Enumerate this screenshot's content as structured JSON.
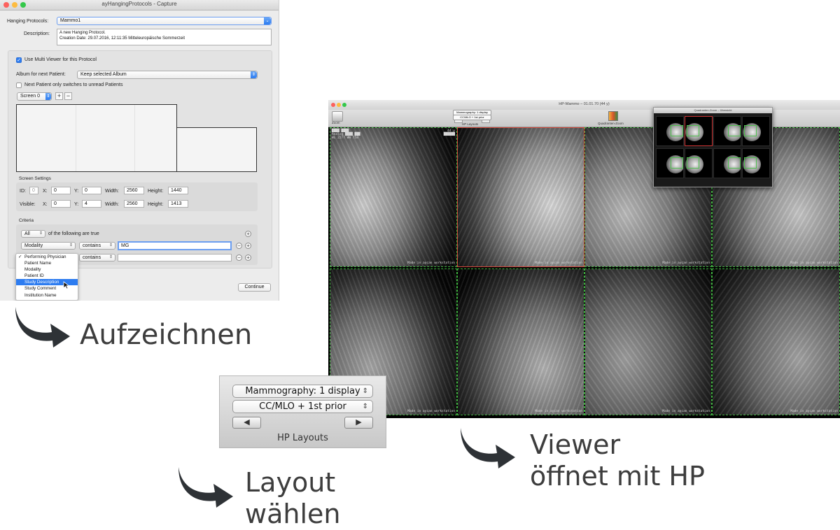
{
  "capture_window": {
    "title": "ayHangingProtocols - Capture",
    "hanging_protocols_label": "Hanging Protocols:",
    "hanging_protocols_value": "Mammo1",
    "description_label": "Description:",
    "description_line1": "A new Hanging Protocol.",
    "description_line2": "Creation Date: 29.07.2016, 12:11:35 Mitteleuropäische Sommerzeit",
    "multi_viewer_label": "Use Multi Viewer for this Protocol",
    "album_label": "Album for next Patient:",
    "album_value": "Keep selected Album",
    "next_patient_label": "Next Patient only switches to unread Patients",
    "screen_select": "Screen 0",
    "add_button": "+",
    "remove_button": "−",
    "screen_settings_title": "Screen Settings",
    "id_label": "ID:",
    "id_value": "0",
    "x_label": "X:",
    "y_label": "Y:",
    "width_label": "Width:",
    "height_label": "Height:",
    "visible_label": "Visible:",
    "screen_row1": {
      "x": "0",
      "y": "0",
      "width": "2560",
      "height": "1440"
    },
    "screen_row2": {
      "x": "0",
      "y": "4",
      "width": "2560",
      "height": "1413"
    },
    "criteria_title": "Criteria",
    "criteria_all": "All",
    "criteria_following": "of the following are true",
    "criteria_rows": [
      {
        "field": "Modality",
        "op": "contains",
        "value": "MG"
      },
      {
        "field": "",
        "op": "contains",
        "value": ""
      }
    ],
    "menu_items": [
      "Performing Physician",
      "Patient Name",
      "Modality",
      "Patient ID",
      "Study Description",
      "Study Comment",
      "Institution Name"
    ],
    "menu_checked": "Performing Physician",
    "menu_selected": "Study Description",
    "continue_button": "Continue"
  },
  "viewer_window": {
    "title": "HP-Mammo – 01.01.70 (44 y)",
    "toolbar_left": "Zoom",
    "toolbar_hp_select1": "Mammography: 1 display",
    "toolbar_hp_select2": "CC/MLO + 1st prior",
    "toolbar_hp_label": "HP Layouts",
    "toolbar_right": "Quadranten-Zoom",
    "quad_title": "Quadranten-Zoom – Übersicht",
    "watermark": "Made in aycan workstation"
  },
  "hp_layouts": {
    "select1": "Mammography: 1 display",
    "select2": "CC/MLO + 1st prior",
    "prev": "◀",
    "next": "▶",
    "label": "HP Layouts"
  },
  "captions": {
    "record": "Aufzeichnen",
    "layout_line1": "Layout",
    "layout_line2": "wählen",
    "viewer_line1": "Viewer",
    "viewer_line2": "öffnet mit HP"
  },
  "colors": {
    "accent_blue": "#2d7cf0",
    "grid_green": "#3fb23f",
    "active_red": "#d24a3c",
    "caption_text": "#3d3d3d",
    "arrow": "#2e3236"
  }
}
